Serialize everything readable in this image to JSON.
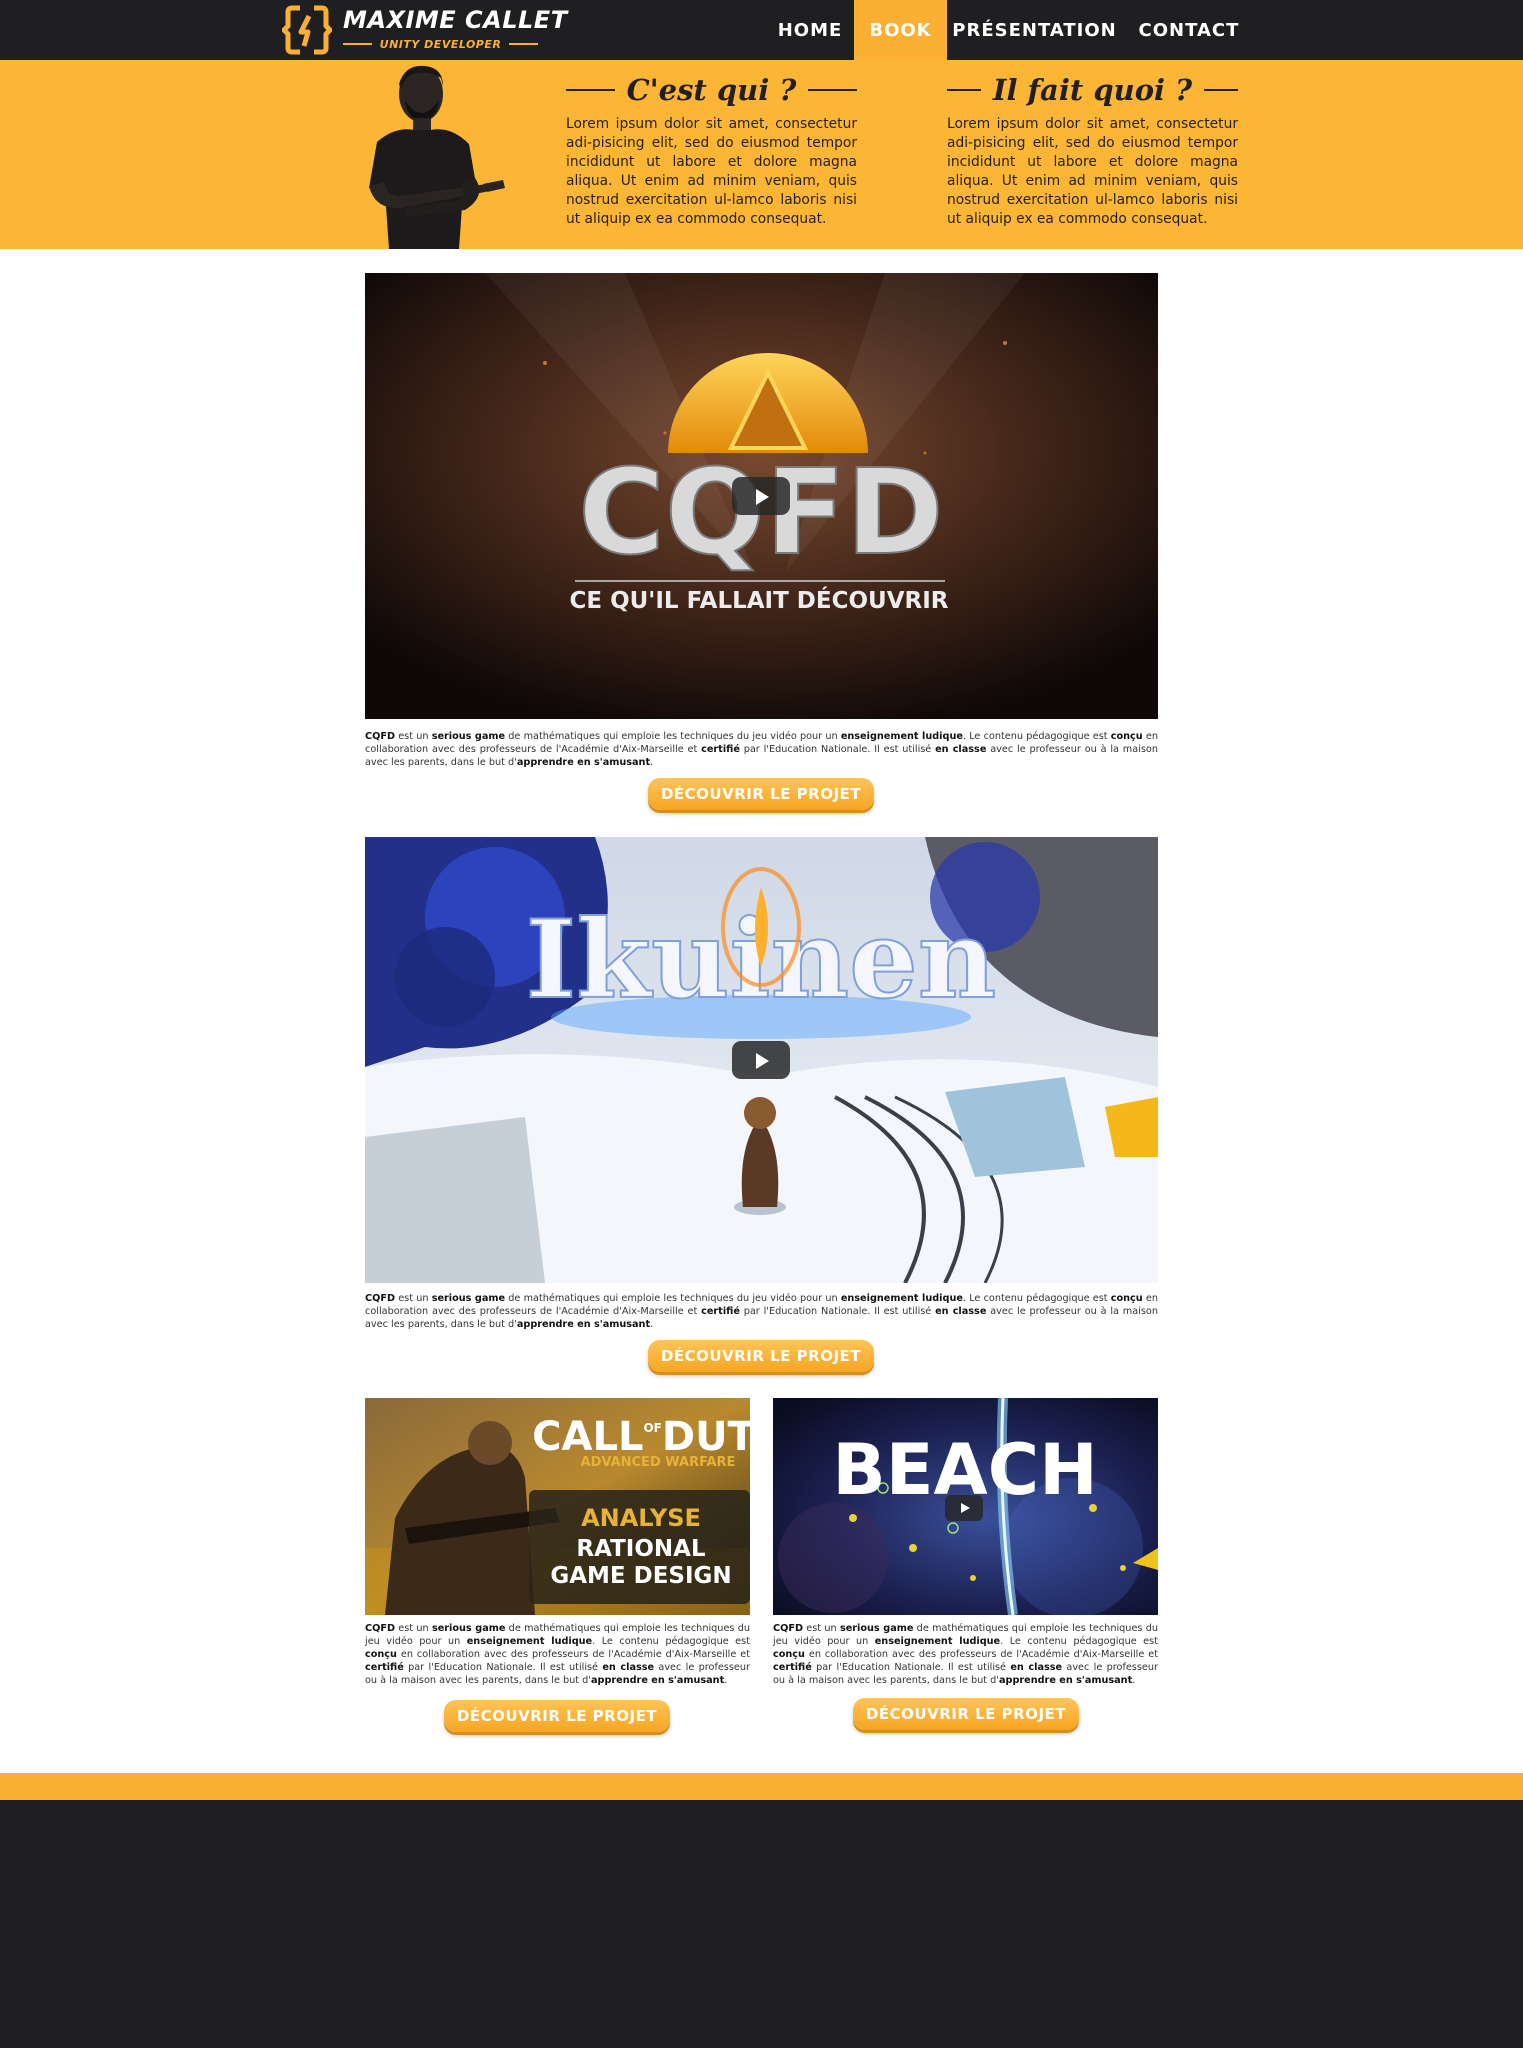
{
  "brand": {
    "name": "MAXIME CALLET",
    "subtitle": "UNITY DEVELOPER"
  },
  "nav": {
    "items": [
      {
        "label": "HOME",
        "active": false
      },
      {
        "label": "BOOK",
        "active": true
      },
      {
        "label": "PRÉSENTATION",
        "active": false
      },
      {
        "label": "CONTACT",
        "active": false
      }
    ]
  },
  "hero": {
    "col1": {
      "title": "C'est qui ?",
      "text": "Lorem ipsum dolor sit amet, consectetur adi-pisicing elit, sed do eiusmod tempor incididunt ut labore et dolore magna aliqua. Ut enim ad minim veniam, quis nostrud exercitation ul-lamco laboris nisi ut aliquip ex ea commodo consequat."
    },
    "col2": {
      "title": "Il fait quoi ?",
      "text": "Lorem ipsum dolor sit amet, consectetur adi-pisicing elit, sed do eiusmod tempor incididunt ut labore et dolore magna aliqua. Ut enim ad minim veniam, quis nostrud exercitation ul-lamco laboris nisi ut aliquip ex ea commodo consequat."
    }
  },
  "projects": {
    "cqfd": {
      "logo": "CQFD",
      "tagline": "CE QU'IL FALLAIT DÉCOUVRIR",
      "cta": "DÉCOUVRIR LE PROJET"
    },
    "ikuinen": {
      "logo": "Ikuinen",
      "cta": "DÉCOUVRIR LE PROJET"
    },
    "cod": {
      "title_line1": "CALL",
      "title_of": "OF",
      "title_line2": "DUTY",
      "subtitle": "ADVANCED WARFARE",
      "badge_line1": "ANALYSE",
      "badge_line2": "RATIONAL",
      "badge_line3": "GAME DESIGN",
      "cta": "DÉCOUVRIR LE PROJET"
    },
    "beach": {
      "logo": "BEACH",
      "cta": "DÉCOUVRIR LE PROJET"
    }
  },
  "description": {
    "s1": "CQFD",
    "s2": " est un ",
    "s3": "serious game",
    "s4": " de mathématiques qui emploie les techniques du jeu vidéo pour un ",
    "s5": "enseignement ludique",
    "s6": ". Le contenu pédagogique est ",
    "s7": "conçu",
    "s8": " en collaboration avec des professeurs de l'Académie d'Aix-Marseille et ",
    "s9": "certifié",
    "s10": " par l'Education Nationale. Il est utilisé ",
    "s11": "en classe",
    "s12": " avec le professeur ou à la maison avec les parents, dans le but d'",
    "s13": "apprendre en s'amusant",
    "s14": "."
  },
  "colors": {
    "accent": "#fbb034",
    "dark": "#1f1f21",
    "text": "#231f20"
  },
  "icons": [
    "logo-mark-icon",
    "play-icon"
  ]
}
